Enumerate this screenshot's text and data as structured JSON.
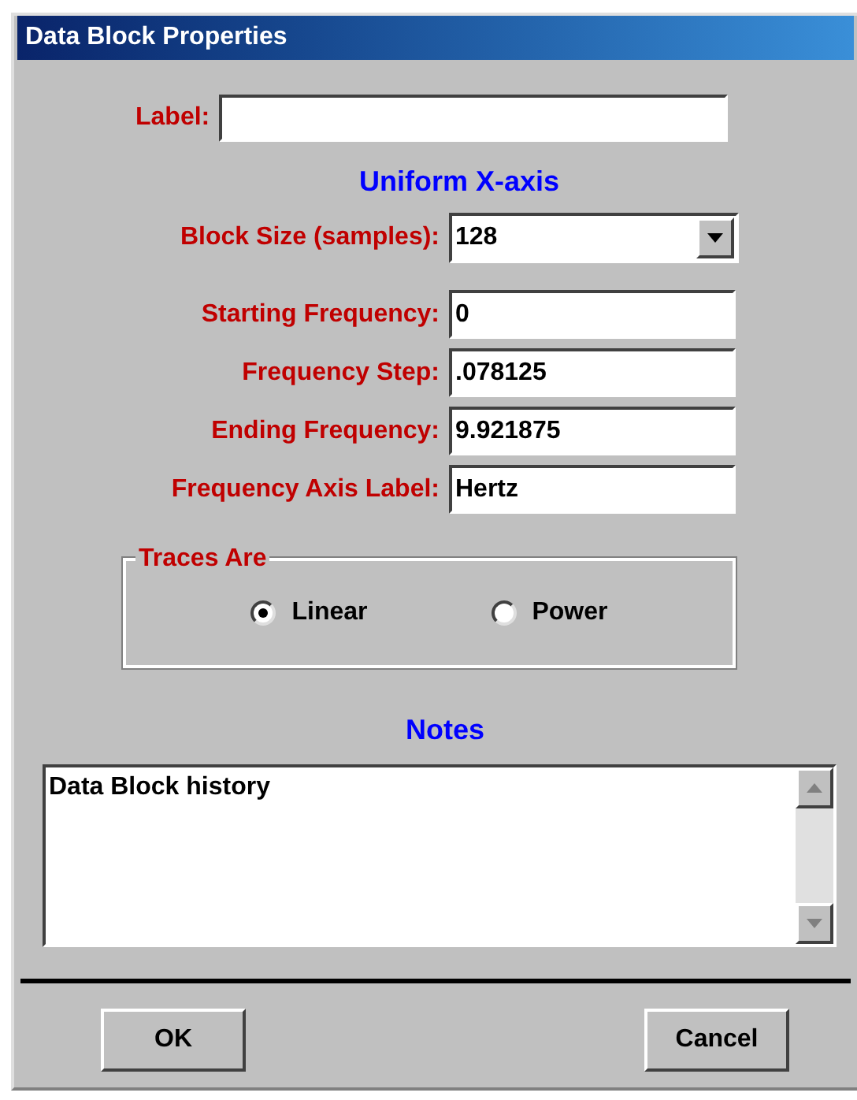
{
  "window": {
    "title": "Data Block Properties"
  },
  "label_field": {
    "label": "Label:"
  },
  "section_heading": "Uniform X-axis",
  "block_size": {
    "label": "Block Size (samples):",
    "value": "128"
  },
  "fields": [
    {
      "label": "Starting Frequency:",
      "value": "0"
    },
    {
      "label": "Frequency Step:",
      "value": ".078125"
    },
    {
      "label": "Ending Frequency:",
      "value": "9.921875"
    },
    {
      "label": "Frequency Axis Label:",
      "value": "Hertz"
    }
  ],
  "traces_group": {
    "title": "Traces Are",
    "options": [
      {
        "label": "Linear",
        "selected": true
      },
      {
        "label": "Power",
        "selected": false
      }
    ]
  },
  "notes": {
    "heading": "Notes",
    "value": "Data Block history"
  },
  "buttons": [
    "OK",
    "Cancel"
  ]
}
